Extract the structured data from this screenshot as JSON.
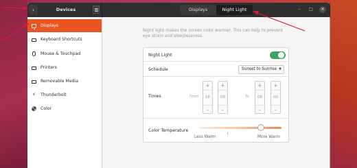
{
  "titlebar": {
    "back_label": "‹",
    "title": "Devices",
    "menu_icon": "hamburger-menu-icon",
    "tabs": [
      {
        "label": "Displays",
        "active": false
      },
      {
        "label": "Night Light",
        "active": true
      }
    ],
    "window_controls": {
      "minimize": "–",
      "maximize": "□",
      "close": "✕"
    }
  },
  "sidebar": {
    "items": [
      {
        "label": "Displays",
        "icon": "monitor-icon",
        "active": true
      },
      {
        "label": "Keyboard Shortcuts",
        "icon": "keyboard-icon",
        "active": false
      },
      {
        "label": "Mouse & Touchpad",
        "icon": "mouse-icon",
        "active": false
      },
      {
        "label": "Printers",
        "icon": "printer-icon",
        "active": false
      },
      {
        "label": "Removable Media",
        "icon": "drive-icon",
        "active": false
      },
      {
        "label": "Thunderbolt",
        "icon": "thunderbolt-icon",
        "active": false
      },
      {
        "label": "Color",
        "icon": "color-icon",
        "active": false
      }
    ]
  },
  "night_light": {
    "description": "Night light makes the screen color warmer. This can help to prevent eye strain and sleeplessness.",
    "toggle_label": "Night Light",
    "toggle_on": true,
    "schedule_label": "Schedule",
    "schedule_value": "Sunset to Sunrise",
    "times_label": "Times",
    "from_label": "From",
    "to_label": "To",
    "from_hour": "16",
    "from_minute": "00",
    "to_hour": "08",
    "to_minute": "00",
    "spin_up": "+",
    "spin_down": "–",
    "temperature_label": "Color Temperature",
    "temperature_less": "Less Warm",
    "temperature_more": "More Warm",
    "temperature_level": 0.75
  },
  "colors": {
    "accent": "#e95420",
    "toggle_on": "#3aa55c",
    "titlebar": "#2f2f2f",
    "annotation_arrows": "#d1203a"
  }
}
